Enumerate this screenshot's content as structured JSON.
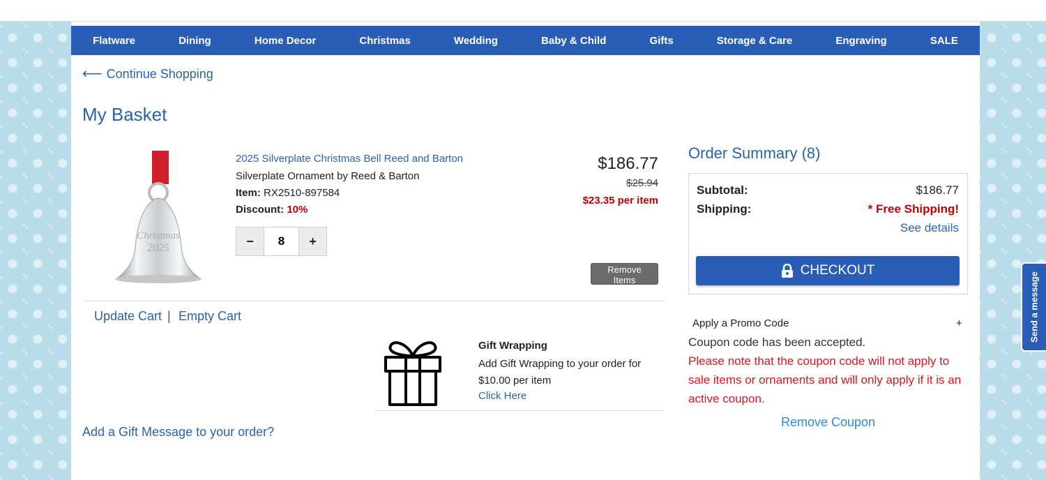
{
  "nav": {
    "items": [
      "Flatware",
      "Dining",
      "Home Decor",
      "Christmas",
      "Wedding",
      "Baby & Child",
      "Gifts",
      "Storage & Care",
      "Engraving",
      "SALE"
    ]
  },
  "continue_shopping": {
    "arrow": "⟵",
    "label": "Continue Shopping"
  },
  "basket_title": "My Basket",
  "item": {
    "image_icon": "silver-bell-ornament-image",
    "image_text_line1": "Christmas",
    "image_text_line2": "2025",
    "title": "2025 Silverplate Christmas Bell Reed and Barton",
    "subtitle": "Silverplate Ornament by Reed & Barton",
    "code_label": "Item:",
    "code_value": "RX2510-897584",
    "discount_label": "Discount:",
    "discount_value": "10%",
    "quantity": "8",
    "minus_label": "−",
    "plus_label": "+",
    "price": "$186.77",
    "original_price": "$25.94",
    "per_item": "$23.35 per item",
    "remove_label": "Remove Items"
  },
  "cart_actions": {
    "update": "Update Cart",
    "separator": "|",
    "empty": "Empty Cart"
  },
  "gift_wrap": {
    "icon": "gift-box-icon",
    "title": "Gift Wrapping",
    "description": "Add Gift Wrapping to your order for $10.00 per item",
    "link": "Click Here"
  },
  "gift_message_link": "Add a Gift Message to your order?",
  "order_summary": {
    "title": "Order Summary (8)",
    "subtotal_label": "Subtotal:",
    "subtotal_value": "$186.77",
    "shipping_label": "Shipping:",
    "shipping_value": "* Free Shipping!",
    "see_details": "See details",
    "checkout_label": "CHECKOUT",
    "checkout_icon": "lock-icon"
  },
  "promo": {
    "label": "Apply a Promo Code",
    "toggle": "+",
    "accepted": "Coupon code has been accepted.",
    "note": "Please note that the coupon code will not apply to sale items or ornaments and will only apply if it is an active coupon.",
    "remove": "Remove Coupon"
  },
  "send_message": "Send a message",
  "colors": {
    "nav_blue": "#2a5db5",
    "link_blue": "#2a63ad",
    "alert_red": "#e0141e",
    "price_red": "#c40000",
    "background": "#b9dcea"
  }
}
